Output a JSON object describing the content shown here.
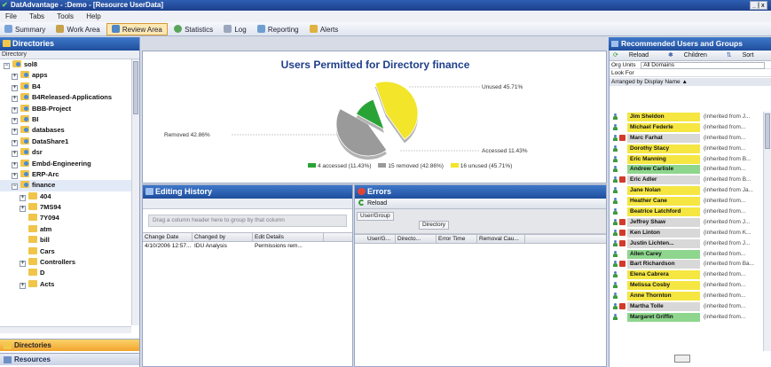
{
  "window": {
    "title": "DatAdvantage - :Demo - [Resource UserData]",
    "controls": "_ | x"
  },
  "menu": [
    "File",
    "Tabs",
    "Tools",
    "Help"
  ],
  "toolbar": [
    {
      "label": "Summary",
      "active": false
    },
    {
      "label": "Work Area",
      "active": false
    },
    {
      "label": "Review Area",
      "active": true
    },
    {
      "label": "Statistics",
      "active": false
    },
    {
      "label": "Log",
      "active": false
    },
    {
      "label": "Reporting",
      "active": false
    },
    {
      "label": "Alerts",
      "active": false
    }
  ],
  "left_pane": {
    "title": "Directories",
    "column": "Directory",
    "tree": [
      {
        "label": "sol8",
        "indent": 0,
        "exp": "−"
      },
      {
        "label": "apps",
        "indent": 1,
        "exp": "+"
      },
      {
        "label": "B4",
        "indent": 1,
        "exp": "+"
      },
      {
        "label": "B4Released-Applications",
        "indent": 1,
        "exp": "+"
      },
      {
        "label": "BBB-Project",
        "indent": 1,
        "exp": "+"
      },
      {
        "label": "BI",
        "indent": 1,
        "exp": "+"
      },
      {
        "label": "databases",
        "indent": 1,
        "exp": "+"
      },
      {
        "label": "DataShare1",
        "indent": 1,
        "exp": "+"
      },
      {
        "label": "dsr",
        "indent": 1,
        "exp": "+"
      },
      {
        "label": "Embd-Engineering",
        "indent": 1,
        "exp": "+"
      },
      {
        "label": "ERP-Arc",
        "indent": 1,
        "exp": "+"
      },
      {
        "label": "finance",
        "indent": 1,
        "exp": "−",
        "selected": true
      },
      {
        "label": "404",
        "indent": 2,
        "exp": "+"
      },
      {
        "label": "7MS94",
        "indent": 2,
        "exp": "+"
      },
      {
        "label": "7Y094",
        "indent": 2,
        "exp": ""
      },
      {
        "label": "atm",
        "indent": 2,
        "exp": ""
      },
      {
        "label": "bill",
        "indent": 2,
        "exp": ""
      },
      {
        "label": "Cars",
        "indent": 2,
        "exp": ""
      },
      {
        "label": "Controllers",
        "indent": 2,
        "exp": "+"
      },
      {
        "label": "D",
        "indent": 2,
        "exp": ""
      },
      {
        "label": "Acts",
        "indent": 2,
        "exp": "+"
      }
    ],
    "nav_directories": "Directories",
    "nav_resources": "Resources"
  },
  "chart_data": {
    "type": "pie",
    "title": "Users Permitted for Directory finance",
    "slices": [
      {
        "label": "Accessed",
        "count": 4,
        "percent": 11.43,
        "color": "#2aa336"
      },
      {
        "label": "Removed",
        "count": 15,
        "percent": 42.86,
        "color": "#9a9a9a"
      },
      {
        "label": "Unused",
        "count": 16,
        "percent": 45.71,
        "color": "#f2e52a"
      }
    ],
    "callouts": {
      "unused": "Unused 45.71%",
      "removed": "Removed 42.86%",
      "accessed": "Accessed 11.43%"
    },
    "legend": [
      "4 accessed (11.43%)",
      "15 removed (42.86%)",
      "16 unused (45.71%)"
    ],
    "legend_position": "bottom"
  },
  "history": {
    "title": "Editing History",
    "group_hint": "Drag a column header here to group by that column",
    "columns": [
      "Change Date",
      "Changed by",
      "Edit Details"
    ],
    "rows": [
      [
        "4/10/2006 12:57...",
        "IDU Analysis",
        "Permissions rem..."
      ]
    ]
  },
  "errors": {
    "title": "Errors",
    "reload": "Reload",
    "group_box1": "User/Group",
    "group_box2": "Directory",
    "columns": [
      "User/G...",
      "Directo...",
      "Error Time",
      "Removal Cau..."
    ]
  },
  "right_pane": {
    "title": "Recommended Users and Groups",
    "tools": [
      "Reload",
      "Children",
      "Sort"
    ],
    "org_units_label": "Org Units",
    "org_units_value": "All Domains",
    "look_for": "Look For",
    "arrange": "Arranged by Display Name",
    "users": [
      {
        "name": "Jim Sheldon",
        "deny": false,
        "color": "#f5e642",
        "inh": "(inherited from J..."
      },
      {
        "name": "Michael Federle",
        "deny": false,
        "color": "#f5e642",
        "inh": "(inherited from..."
      },
      {
        "name": "Marc Farhat",
        "deny": true,
        "color": "#d8d8d8",
        "inh": "(inherited from..."
      },
      {
        "name": "Dorothy Stacy",
        "deny": false,
        "color": "#f5e642",
        "inh": "(inherited from..."
      },
      {
        "name": "Eric Manning",
        "deny": false,
        "color": "#f5e642",
        "inh": "(inherited from B..."
      },
      {
        "name": "Andrew Carlisle",
        "deny": false,
        "color": "#8ed68e",
        "inh": "(inherited from..."
      },
      {
        "name": "Eric Adler",
        "deny": true,
        "color": "#d8d8d8",
        "inh": "(inherited from B..."
      },
      {
        "name": "Jane Nolan",
        "deny": false,
        "color": "#f5e642",
        "inh": "(inherited from Ja..."
      },
      {
        "name": "Heather Cane",
        "deny": false,
        "color": "#f5e642",
        "inh": "(inherited from..."
      },
      {
        "name": "Beatrice Latchford",
        "deny": false,
        "color": "#f5e642",
        "inh": "(inherited from..."
      },
      {
        "name": "Jeffrey Shaw",
        "deny": true,
        "color": "#d8d8d8",
        "inh": "(inherited from J..."
      },
      {
        "name": "Ken Linton",
        "deny": true,
        "color": "#d8d8d8",
        "inh": "(inherited from K..."
      },
      {
        "name": "Justin Lichten...",
        "deny": true,
        "color": "#d8d8d8",
        "inh": "(inherited from J..."
      },
      {
        "name": "Allen Carey",
        "deny": false,
        "color": "#8ed68e",
        "inh": "(inherited from..."
      },
      {
        "name": "Bart Richardson",
        "deny": true,
        "color": "#d8d8d8",
        "inh": "(inherited from Ba..."
      },
      {
        "name": "Elena Cabrera",
        "deny": false,
        "color": "#f5e642",
        "inh": "(inherited from..."
      },
      {
        "name": "Melissa Cosby",
        "deny": false,
        "color": "#f5e642",
        "inh": "(inherited from..."
      },
      {
        "name": "Anne Thornton",
        "deny": false,
        "color": "#f5e642",
        "inh": "(inherited from..."
      },
      {
        "name": "Martha Tolle",
        "deny": true,
        "color": "#d8d8d8",
        "inh": "(inherited from..."
      },
      {
        "name": "Margaret Griffin",
        "deny": false,
        "color": "#8ed68e",
        "inh": "(inherited from..."
      }
    ]
  }
}
